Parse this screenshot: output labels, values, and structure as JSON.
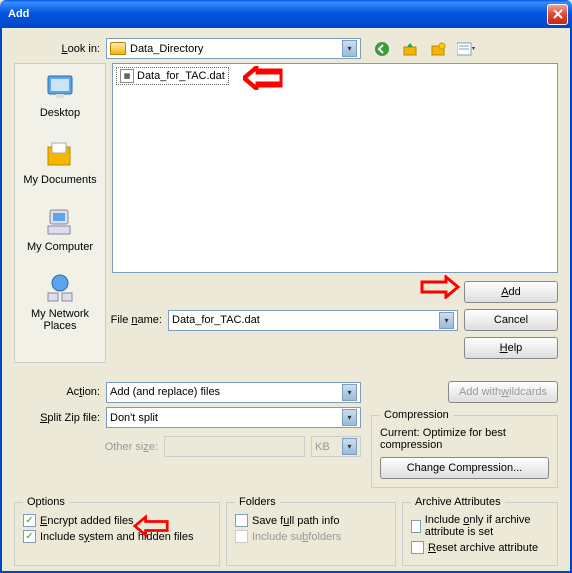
{
  "title": "Add",
  "look_in_label": "Look in:",
  "look_in_value": "Data_Directory",
  "file_item": "Data_for_TAC.dat",
  "places": {
    "desktop": "Desktop",
    "mydocs": "My Documents",
    "mycomp": "My Computer",
    "mynet": "My Network Places"
  },
  "filename_label": "File name:",
  "filename_value": "Data_for_TAC.dat",
  "buttons": {
    "add": "Add",
    "cancel": "Cancel",
    "help": "Help",
    "add_wildcards": "Add with wildcards",
    "change_compression": "Change Compression..."
  },
  "action_label": "Action:",
  "action_value": "Add (and replace) files",
  "split_label": "Split Zip file:",
  "split_value": "Don't split",
  "other_size_label": "Other size:",
  "other_unit": "KB",
  "compression": {
    "legend": "Compression",
    "current_label": "Current: Optimize for best compression"
  },
  "options": {
    "legend": "Options",
    "encrypt": "Encrypt added files",
    "include_hidden": "Include system and hidden files"
  },
  "folders": {
    "legend": "Folders",
    "save_full": "Save full path info",
    "include_sub": "Include subfolders"
  },
  "archive": {
    "legend": "Archive Attributes",
    "include_only": "Include only if archive attribute is set",
    "reset": "Reset archive attribute"
  }
}
